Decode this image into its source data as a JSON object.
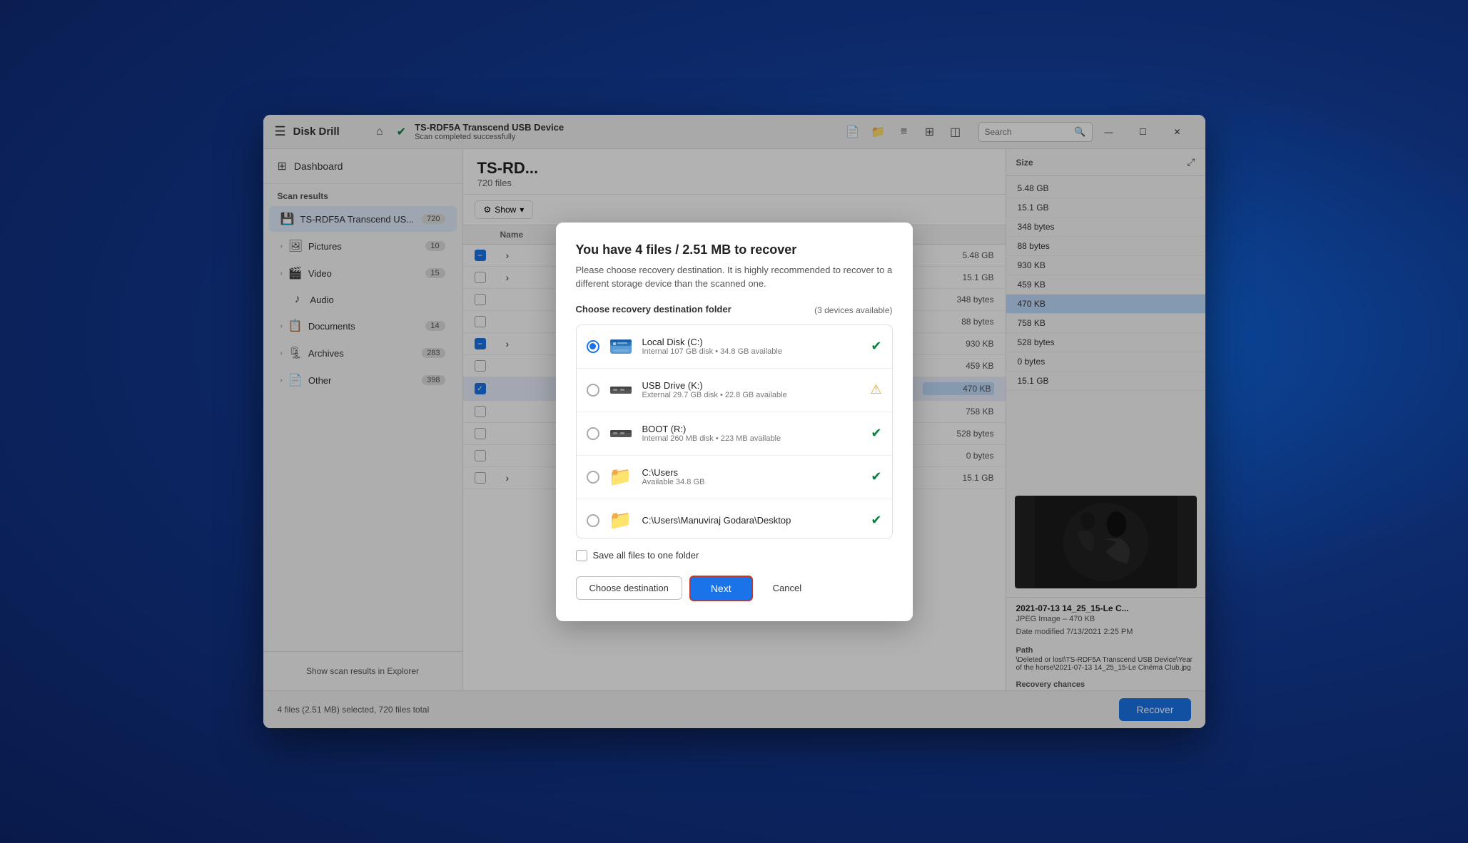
{
  "window": {
    "title": "Disk Drill",
    "controls": {
      "minimize": "—",
      "maximize": "☐",
      "close": "✕"
    }
  },
  "titlebar": {
    "device_name": "TS-RDF5A Transcend USB Device",
    "device_status": "Scan completed successfully",
    "search_placeholder": "Search"
  },
  "sidebar": {
    "dashboard_label": "Dashboard",
    "scan_results_label": "Scan results",
    "items": [
      {
        "id": "ts-rdf5a",
        "label": "TS-RDF5A Transcend US...",
        "count": "720",
        "active": true
      },
      {
        "id": "pictures",
        "label": "Pictures",
        "count": "10"
      },
      {
        "id": "video",
        "label": "Video",
        "count": "15"
      },
      {
        "id": "audio",
        "label": "Audio",
        "count": ""
      },
      {
        "id": "documents",
        "label": "Documents",
        "count": "14"
      },
      {
        "id": "archives",
        "label": "Archives",
        "count": "283"
      },
      {
        "id": "other",
        "label": "Other",
        "count": "398"
      }
    ],
    "footer_btn": "Show scan results in Explorer"
  },
  "file_area": {
    "title": "TS-RD...",
    "subtitle": "720 files",
    "toolbar": {
      "show_label": "Show"
    },
    "table": {
      "col_name": "Name",
      "col_size": "Size"
    },
    "rows": [
      {
        "id": 1,
        "name": "",
        "size": "5.48 GB",
        "checked": "minus"
      },
      {
        "id": 2,
        "name": "",
        "size": "15.1 GB",
        "checked": false
      },
      {
        "id": 3,
        "name": "",
        "size": "348 bytes",
        "checked": false
      },
      {
        "id": 4,
        "name": "",
        "size": "88 bytes",
        "checked": false
      },
      {
        "id": 5,
        "name": "",
        "size": "930 KB",
        "checked": "minus"
      },
      {
        "id": 6,
        "name": "",
        "size": "459 KB",
        "checked": false
      },
      {
        "id": 7,
        "name": "",
        "size": "470 KB",
        "checked": true
      },
      {
        "id": 8,
        "name": "",
        "size": "758 KB",
        "checked": false
      },
      {
        "id": 9,
        "name": "",
        "size": "528 bytes",
        "checked": false
      },
      {
        "id": 10,
        "name": "",
        "size": "0 bytes",
        "checked": false
      },
      {
        "id": 11,
        "name": "",
        "size": "15.1 GB",
        "checked": false
      }
    ]
  },
  "preview": {
    "col_label": "Size",
    "sizes": [
      "5.48 GB",
      "15.1 GB",
      "348 bytes",
      "88 bytes",
      "930 KB",
      "459 KB",
      "470 KB",
      "758 KB",
      "528 bytes",
      "0 bytes",
      "15.1 GB"
    ],
    "highlighted_index": 6,
    "filename": "2021-07-13 14_25_15-Le C...",
    "filetype": "JPEG Image – 470 KB",
    "date_modified": "Date modified 7/13/2021 2:25 PM",
    "path_label": "Path",
    "path": "\\Deleted or lost\\TS-RDF5A Transcend USB Device\\Year of the horse\\2021-07-13 14_25_15-Le Cinéma Club.jpg",
    "recovery_chances_label": "Recovery chances"
  },
  "status_bar": {
    "text": "4 files (2.51 MB) selected, 720 files total",
    "recover_btn": "Recover"
  },
  "modal": {
    "title": "You have 4 files / 2.51 MB to recover",
    "subtitle": "Please choose recovery destination. It is highly recommended to recover to a different storage device than the scanned one.",
    "section_label": "Choose recovery destination folder",
    "devices_available": "(3 devices available)",
    "devices": [
      {
        "id": "local-disk-c",
        "name": "Local Disk (C:)",
        "desc": "Internal 107 GB disk • 34.8 GB available",
        "status": "ok",
        "selected": true,
        "icon_type": "hdd"
      },
      {
        "id": "usb-drive-k",
        "name": "USB Drive (K:)",
        "desc": "External 29.7 GB disk • 22.8 GB available",
        "status": "warn",
        "selected": false,
        "icon_type": "usb"
      },
      {
        "id": "boot-r",
        "name": "BOOT (R:)",
        "desc": "Internal 260 MB disk • 223 MB available",
        "status": "ok",
        "selected": false,
        "icon_type": "usb"
      },
      {
        "id": "c-users",
        "name": "C:\\Users",
        "desc": "Available 34.8 GB",
        "status": "ok",
        "selected": false,
        "icon_type": "folder"
      },
      {
        "id": "c-users-desktop",
        "name": "C:\\Users\\Manuviraj Godara\\Desktop",
        "desc": "",
        "status": "ok",
        "selected": false,
        "icon_type": "folder"
      }
    ],
    "save_all_label": "Save all files to one folder",
    "choose_destination_btn": "Choose destination",
    "next_btn": "Next",
    "cancel_btn": "Cancel"
  }
}
